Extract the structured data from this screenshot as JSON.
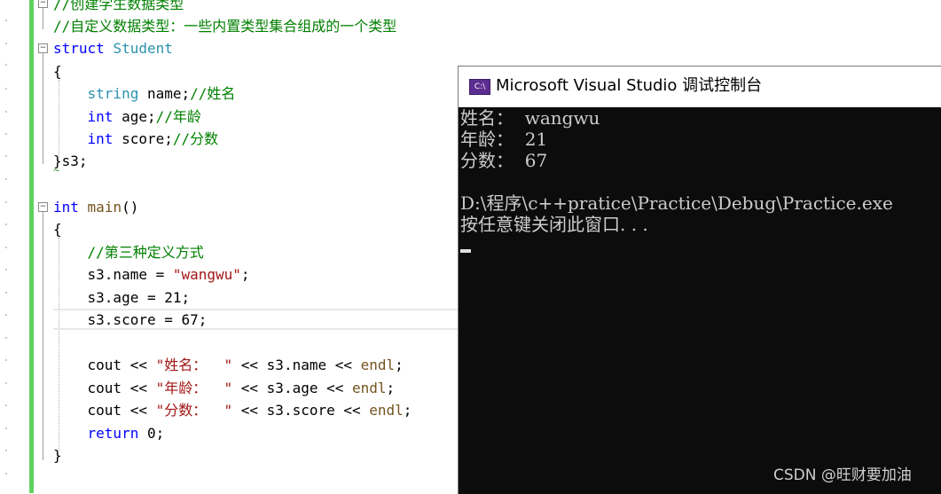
{
  "editor": {
    "lines": [
      {
        "id": "l0",
        "parts": [
          {
            "c": "cm",
            "t": "//创建学生数据类型"
          }
        ]
      },
      {
        "id": "l1",
        "parts": [
          {
            "c": "cm",
            "t": "//自定义数据类型：一些内置类型集合组成的一个类型"
          }
        ]
      },
      {
        "id": "l2",
        "parts": [
          {
            "c": "kw",
            "t": "struct"
          },
          {
            "c": "",
            "t": " "
          },
          {
            "c": "ty",
            "t": "Student"
          }
        ]
      },
      {
        "id": "l3",
        "parts": [
          {
            "c": "",
            "t": "{"
          }
        ]
      },
      {
        "id": "l4",
        "parts": [
          {
            "c": "",
            "t": "    "
          },
          {
            "c": "ty",
            "t": "string"
          },
          {
            "c": "",
            "t": " name;"
          },
          {
            "c": "cm",
            "t": "//姓名"
          }
        ]
      },
      {
        "id": "l5",
        "parts": [
          {
            "c": "",
            "t": "    "
          },
          {
            "c": "kw",
            "t": "int"
          },
          {
            "c": "",
            "t": " age;"
          },
          {
            "c": "cm",
            "t": "//年龄"
          }
        ]
      },
      {
        "id": "l6",
        "parts": [
          {
            "c": "",
            "t": "    "
          },
          {
            "c": "kw",
            "t": "int"
          },
          {
            "c": "",
            "t": " score;"
          },
          {
            "c": "cm",
            "t": "//分数"
          }
        ]
      },
      {
        "id": "l7",
        "parts": [
          {
            "c": "",
            "t": "}s3;"
          }
        ]
      },
      {
        "id": "l8",
        "parts": [
          {
            "c": "",
            "t": ""
          }
        ]
      },
      {
        "id": "l9",
        "parts": [
          {
            "c": "kw",
            "t": "int"
          },
          {
            "c": "",
            "t": " "
          },
          {
            "c": "fn",
            "t": "main"
          },
          {
            "c": "",
            "t": "()"
          }
        ]
      },
      {
        "id": "l10",
        "parts": [
          {
            "c": "",
            "t": "{"
          }
        ]
      },
      {
        "id": "l11",
        "parts": [
          {
            "c": "",
            "t": "    "
          },
          {
            "c": "cm",
            "t": "//第三种定义方式"
          }
        ]
      },
      {
        "id": "l12",
        "parts": [
          {
            "c": "",
            "t": "    s3.name = "
          },
          {
            "c": "str",
            "t": "\"wangwu\""
          },
          {
            "c": "",
            "t": ";"
          }
        ]
      },
      {
        "id": "l13",
        "parts": [
          {
            "c": "",
            "t": "    s3.age = 21;"
          }
        ]
      },
      {
        "id": "l14",
        "parts": [
          {
            "c": "",
            "t": "    s3.score = 67;"
          }
        ]
      },
      {
        "id": "l15",
        "parts": [
          {
            "c": "",
            "t": ""
          }
        ]
      },
      {
        "id": "l16",
        "parts": [
          {
            "c": "",
            "t": "    cout << "
          },
          {
            "c": "str",
            "t": "\"姓名：  \""
          },
          {
            "c": "",
            "t": " << s3.name << "
          },
          {
            "c": "fn",
            "t": "endl"
          },
          {
            "c": "",
            "t": ";"
          }
        ]
      },
      {
        "id": "l17",
        "parts": [
          {
            "c": "",
            "t": "    cout << "
          },
          {
            "c": "str",
            "t": "\"年龄：  \""
          },
          {
            "c": "",
            "t": " << s3.age << "
          },
          {
            "c": "fn",
            "t": "endl"
          },
          {
            "c": "",
            "t": ";"
          }
        ]
      },
      {
        "id": "l18",
        "parts": [
          {
            "c": "",
            "t": "    cout << "
          },
          {
            "c": "str",
            "t": "\"分数：  \""
          },
          {
            "c": "",
            "t": " << s3.score << "
          },
          {
            "c": "fn",
            "t": "endl"
          },
          {
            "c": "",
            "t": ";"
          }
        ]
      },
      {
        "id": "l19",
        "parts": [
          {
            "c": "",
            "t": "    "
          },
          {
            "c": "kw",
            "t": "return"
          },
          {
            "c": "",
            "t": " 0;"
          }
        ]
      },
      {
        "id": "l20",
        "parts": [
          {
            "c": "",
            "t": "}"
          }
        ]
      }
    ],
    "fold_icons": [
      "minus-icon",
      "minus-icon",
      "minus-icon"
    ]
  },
  "console": {
    "icon_label": "C:\\",
    "title": "Microsoft Visual Studio 调试控制台",
    "output": [
      "姓名：  wangwu",
      "年龄：  21",
      "分数：  67",
      "",
      "D:\\程序\\c++pratice\\Practice\\Debug\\Practice.exe",
      "按任意键关闭此窗口. . ."
    ]
  },
  "watermark": "CSDN @旺财要加油",
  "colors": {
    "keyword": "#0000ff",
    "type": "#2b91af",
    "comment": "#008000",
    "string": "#a31515",
    "function": "#74531f",
    "change_bar": "#5fd35f",
    "console_bg": "#0c0c0c",
    "console_text": "#cccccc"
  }
}
